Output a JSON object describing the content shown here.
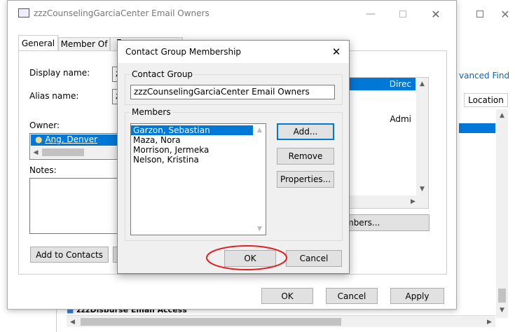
{
  "owners_window": {
    "title": "zzzCounselingGarciaCenter Email Owners",
    "tabs": [
      "General",
      "Member Of",
      "E"
    ],
    "display_name_label": "Display name:",
    "display_name_value": "z",
    "alias_label": "Alias name:",
    "alias_value": "z",
    "owner_label": "Owner:",
    "owner_value": "Ang, Denver",
    "notes_label": "Notes:",
    "add_to_contacts": "Add to Contacts",
    "ok": "OK",
    "cancel": "Cancel",
    "apply": "Apply"
  },
  "background_window": {
    "advanced_find": "vanced Find",
    "location_header": "Location",
    "row1_location": "Direc",
    "row2_location": "Admi",
    "members_button": "mbers...",
    "bottom_item": "zzzDisburse Email Access"
  },
  "membership_dialog": {
    "title": "Contact Group Membership",
    "contact_group_label": "Contact Group",
    "contact_group_value": "zzzCounselingGarciaCenter Email Owners",
    "members_label": "Members",
    "members": [
      "Garzon, Sebastian",
      "Maza, Nora",
      "Morrison, Jermeka",
      "Nelson, Kristina"
    ],
    "add": "Add...",
    "remove": "Remove",
    "properties": "Properties...",
    "ok": "OK",
    "cancel": "Cancel"
  },
  "colors": {
    "selection": "#0078d7",
    "highlight_circle": "#e02020"
  }
}
